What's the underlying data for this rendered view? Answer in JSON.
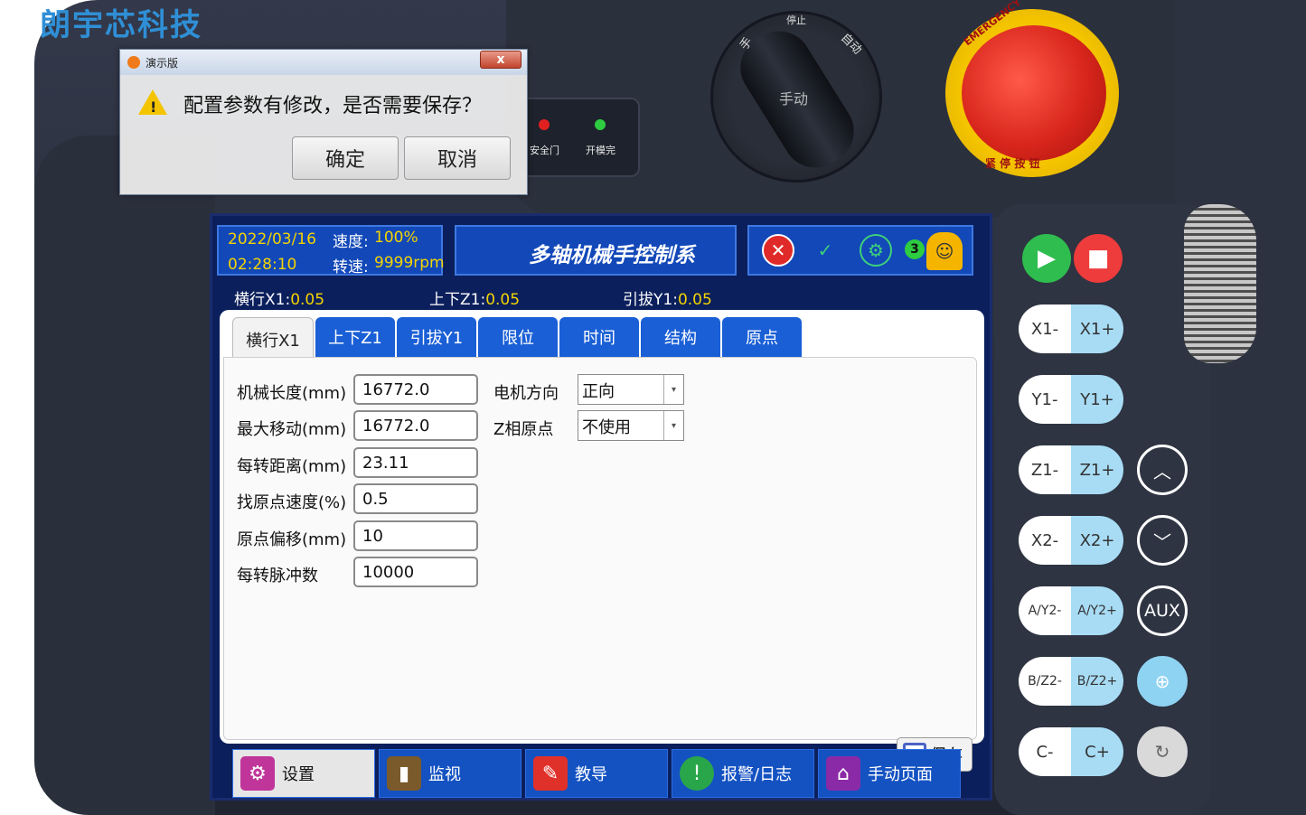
{
  "brand": "朗宇芯科技",
  "indicators": [
    {
      "label": "安全门",
      "color": "#e02020"
    },
    {
      "label": "开模完",
      "color": "#2ecc40"
    }
  ],
  "mode_knob": {
    "left_label": "手",
    "top_label": "停止",
    "right_label": "自动",
    "current": "手动"
  },
  "estop": {
    "top_text": "EMERGENCY",
    "bottom_text": "紧 停 按 钮"
  },
  "screen": {
    "date": "2022/03/16",
    "time": "02:28:10",
    "speed_label": "速度:",
    "speed_value": "100%",
    "rpm_label": "转速:",
    "rpm_value": "9999rpm",
    "title": "多轴机械手控制系",
    "alarm_count": "3",
    "status": [
      {
        "label": "横行X1:",
        "value": "0.05"
      },
      {
        "label": "上下Z1:",
        "value": "0.05"
      },
      {
        "label": "引拔Y1:",
        "value": "0.05"
      }
    ],
    "tabs": [
      "横行X1",
      "上下Z1",
      "引拔Y1",
      "限位",
      "时间",
      "结构",
      "原点"
    ],
    "active_tab": "横行X1",
    "fields": [
      {
        "label": "机械长度(mm)",
        "value": "16772.0"
      },
      {
        "label": "最大移动(mm)",
        "value": "16772.0"
      },
      {
        "label": "每转距离(mm)",
        "value": "23.11"
      },
      {
        "label": "找原点速度(%)",
        "value": "0.5"
      },
      {
        "label": "原点偏移(mm)",
        "value": "10"
      },
      {
        "label": "每转脉冲数",
        "value": "10000"
      }
    ],
    "selects": [
      {
        "label": "电机方向",
        "value": "正向"
      },
      {
        "label": "Z相原点",
        "value": "不使用"
      }
    ],
    "save_label": "保存",
    "nav": [
      {
        "label": "设置",
        "icon": "gear-icon",
        "color": "#c0359a"
      },
      {
        "label": "监视",
        "icon": "monitor-icon",
        "color": "#7a5a2a"
      },
      {
        "label": "教导",
        "icon": "teach-icon",
        "color": "#e0302a"
      },
      {
        "label": "报警/日志",
        "icon": "alarm-icon",
        "color": "#2aa64a"
      },
      {
        "label": "手动页面",
        "icon": "home-icon",
        "color": "#8a2aa6"
      }
    ]
  },
  "keypad": {
    "jog": [
      {
        "minus": "X1-",
        "plus": "X1+"
      },
      {
        "minus": "Y1-",
        "plus": "Y1+"
      },
      {
        "minus": "Z1-",
        "plus": "Z1+"
      },
      {
        "minus": "X2-",
        "plus": "X2+"
      },
      {
        "minus": "A/Y2-",
        "plus": "A/Y2+"
      },
      {
        "minus": "B/Z2-",
        "plus": "B/Z2+"
      },
      {
        "minus": "C-",
        "plus": "C+"
      }
    ],
    "aux_label": "AUX"
  },
  "dialog": {
    "title": "演示版",
    "close": "x",
    "message": "配置参数有修改，是否需要保存？",
    "ok": "确定",
    "cancel": "取消"
  }
}
